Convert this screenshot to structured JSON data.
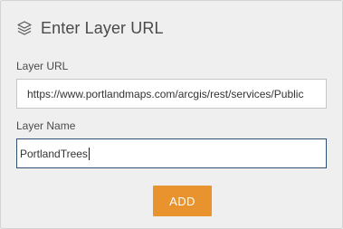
{
  "dialog": {
    "title": "Enter Layer URL",
    "title_icon": "layers-icon"
  },
  "layer_url": {
    "label": "Layer URL",
    "value": "https://www.portlandmaps.com/arcgis/rest/services/Public"
  },
  "layer_name": {
    "label": "Layer Name",
    "value": "PortlandTrees"
  },
  "actions": {
    "add_label": "ADD"
  },
  "colors": {
    "panel_background": "#efefef",
    "accent_button": "#e8932e",
    "focused_border": "#2f4f73",
    "text": "#4a4a4a"
  }
}
